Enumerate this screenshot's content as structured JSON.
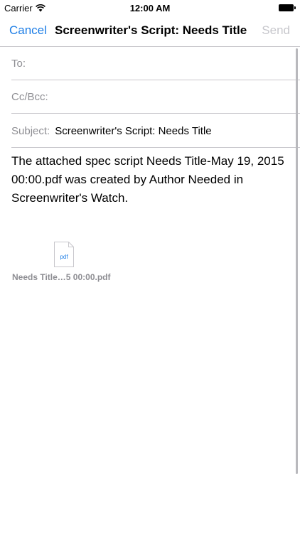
{
  "status_bar": {
    "carrier": "Carrier",
    "time": "12:00 AM"
  },
  "nav": {
    "cancel_label": "Cancel",
    "title": "Screenwriter's Script: Needs Title",
    "send_label": "Send"
  },
  "fields": {
    "to_label": "To:",
    "cc_label": "Cc/Bcc:",
    "subject_label": "Subject:",
    "subject_value": "Screenwriter's Script: Needs Title"
  },
  "message": {
    "body": "The attached spec script Needs Title-May 19, 2015 00:00.pdf was created by Author Needed in Screenwriter's Watch."
  },
  "attachment": {
    "icon_label": "pdf",
    "name": "Needs Title…5 00:00.pdf"
  },
  "colors": {
    "accent": "#1e7ee6",
    "disabled": "#c7c7cc",
    "label_gray": "#8e8e93",
    "separator": "#c8c7cc"
  },
  "icons": [
    "wifi-icon",
    "battery-icon",
    "pdf-icon"
  ]
}
